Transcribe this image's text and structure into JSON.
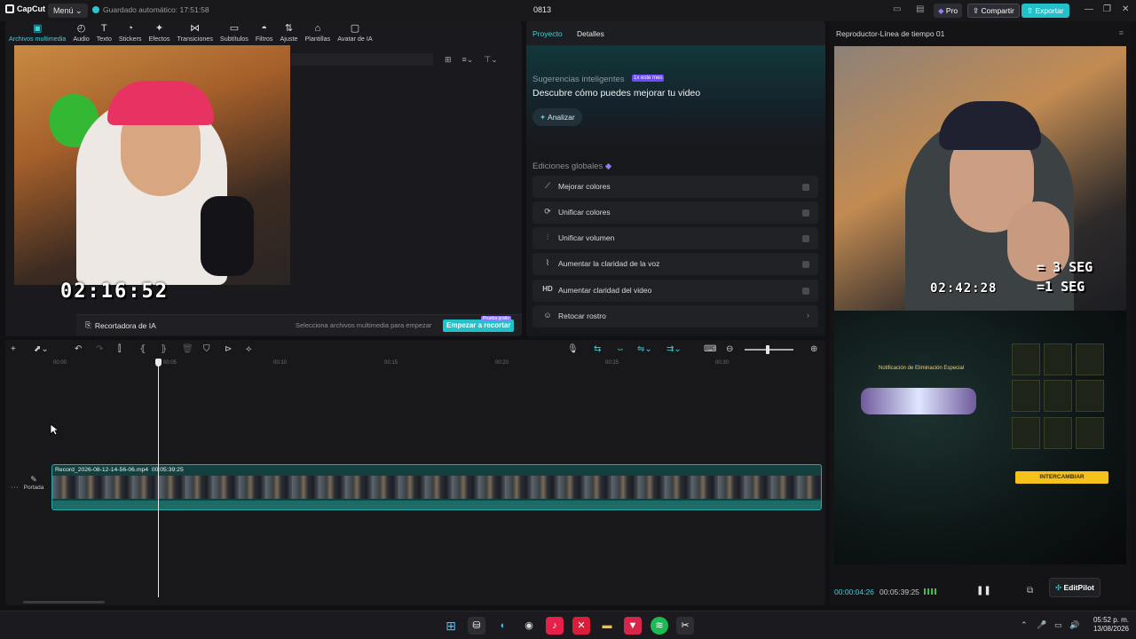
{
  "titlebar": {
    "app_name": "CapCut",
    "menu_label": "Menú",
    "autosave": "Guardado automático: 17:51:58",
    "project_name": "0813",
    "pro_label": "Pro",
    "share_label": "Compartir",
    "export_label": "Exportar"
  },
  "tools": [
    {
      "label": "Archivos multimedia",
      "icon": "media-icon"
    },
    {
      "label": "Audio",
      "icon": "audio-icon"
    },
    {
      "label": "Texto",
      "icon": "text-icon"
    },
    {
      "label": "Stickers",
      "icon": "sticker-icon"
    },
    {
      "label": "Efectos",
      "icon": "effects-icon"
    },
    {
      "label": "Transiciones",
      "icon": "transitions-icon"
    },
    {
      "label": "Subtítulos",
      "icon": "subtitles-icon"
    },
    {
      "label": "Filtros",
      "icon": "filters-icon"
    },
    {
      "label": "Ajuste",
      "icon": "adjust-icon"
    },
    {
      "label": "Plantillas",
      "icon": "templates-icon"
    },
    {
      "label": "Avatar de IA",
      "icon": "ai-avatar-icon"
    }
  ],
  "media": {
    "overlay_timecode": "02:16:52",
    "ai_cutter_label": "Recortadora de IA",
    "ai_hint": "Selecciona archivos multimedia para empezar",
    "start_button": "Empezar a recortar",
    "trial_badge": "Prueba gratis"
  },
  "details": {
    "tab_project": "Proyecto",
    "tab_details": "Detalles",
    "suggestions_title": "Sugerencias inteligentes",
    "suggestions_badge": "1x este mes",
    "suggestions_text": "Descubre cómo puedes mejorar tu video",
    "analyze_label": "Analizar",
    "global_title": "Ediciones globales",
    "items": [
      {
        "label": "Mejorar colores",
        "icon": "magic-wand-icon"
      },
      {
        "label": "Unificar colores",
        "icon": "color-match-icon"
      },
      {
        "label": "Unificar volumen",
        "icon": "volume-sliders-icon"
      },
      {
        "label": "Aumentar la claridad de la voz",
        "icon": "voice-wave-icon"
      },
      {
        "label": "Aumentar claridad del video",
        "icon": "hd-icon"
      },
      {
        "label": "Retocar rostro",
        "icon": "face-retouch-icon"
      }
    ]
  },
  "player": {
    "title": "Reproductor-Línea de tiempo 01",
    "video_timecode": "02:42:28",
    "seg_line1": "= 3 SEG",
    "seg_line2": "=1 SEG",
    "game_notification": "Notificación de Eliminación Especial",
    "game_button": "INTERCAMBIAR",
    "current_time": "00:00:04:26",
    "total_time": "00:05:39:25",
    "editpilot_label": "EditPilot"
  },
  "timeline": {
    "ticks": [
      "00:00",
      "00:05",
      "00:10",
      "00:15",
      "00:20",
      "00:25",
      "00:30"
    ],
    "clip_name": "Record_2026-08-12-14-56-06.mp4",
    "clip_duration": "00:05:39:25",
    "cover_label": "Portada"
  },
  "taskbar": {
    "time": "05:52 p. m.",
    "date": "13/08/2026"
  }
}
